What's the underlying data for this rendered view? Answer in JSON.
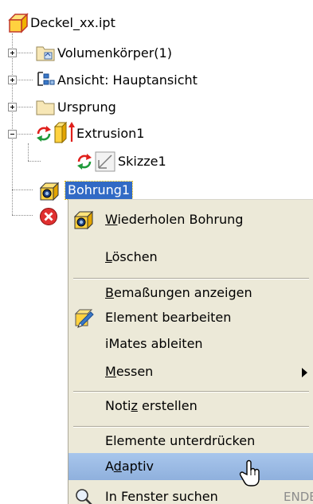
{
  "tree": {
    "root": {
      "label": "Deckel_xx.ipt",
      "icon": "part-file-icon"
    },
    "nodes": [
      {
        "label": "Volumenkörper(1)",
        "icon": "solid-bodies-folder-icon",
        "expander": "plus"
      },
      {
        "label": "Ansicht: Hauptansicht",
        "icon": "view-representation-icon",
        "expander": "plus"
      },
      {
        "label": "Ursprung",
        "icon": "origin-folder-icon",
        "expander": "plus"
      },
      {
        "label": "Extrusion1",
        "icon": "extrusion-icon",
        "expander": "minus",
        "status": "update-needed"
      },
      {
        "label": "Skizze1",
        "icon": "sketch-icon",
        "status": "update-needed"
      },
      {
        "label": "Bohrung1",
        "icon": "hole-feature-icon",
        "selected": true
      },
      {
        "label": "",
        "icon": "error-icon"
      }
    ]
  },
  "context_menu": {
    "items": [
      {
        "pre": "",
        "u": "W",
        "post": "iederholen Bohrung",
        "icon": "hole-feature-icon"
      },
      {
        "pre": "",
        "u": "L",
        "post": "öschen"
      },
      {
        "pre": "",
        "u": "B",
        "post": "emaßungen anzeigen"
      },
      {
        "pre": "Element bearbeiten",
        "u": "",
        "post": "",
        "icon": "edit-feature-icon"
      },
      {
        "pre": "iMates ableiten",
        "u": "",
        "post": ""
      },
      {
        "pre": "",
        "u": "M",
        "post": "essen",
        "submenu": true
      },
      {
        "pre": "Noti",
        "u": "z",
        "post": " erstellen"
      },
      {
        "pre": "Elemente unterdrücken",
        "u": "",
        "post": ""
      },
      {
        "pre": "A",
        "u": "d",
        "post": "aptiv",
        "hover": true
      },
      {
        "pre": "In Fenster suchen",
        "u": "",
        "post": "",
        "shortcut": "ENDE",
        "icon": "find-in-window-icon"
      }
    ]
  },
  "colors": {
    "menu_background": "#ece9d8",
    "hover": "#9fbde7",
    "selection": "#316ac5",
    "update_arrows": "#e0201c"
  }
}
